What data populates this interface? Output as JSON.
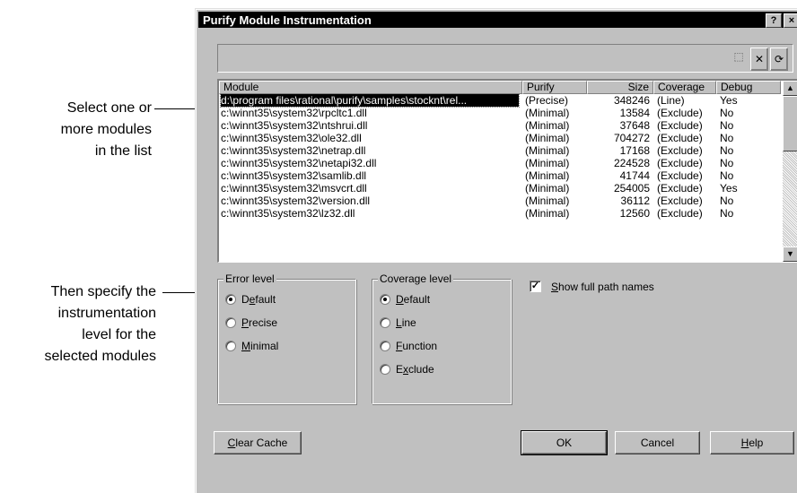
{
  "callouts": {
    "select": [
      "Select one or",
      "more modules",
      "in the list"
    ],
    "specify": [
      "Then specify the",
      "instrumentation",
      "level for the",
      "selected modules"
    ]
  },
  "window": {
    "title": "Purify Module Instrumentation",
    "help_btn": "?",
    "close_btn": "×"
  },
  "toolbar": {
    "icons": [
      "new-icon",
      "delete-icon",
      "refresh-icon"
    ],
    "delete_glyph": "✕",
    "refresh_glyph": "⟳",
    "new_glyph": "⬚"
  },
  "list": {
    "columns": [
      "Module",
      "Purify",
      "Size",
      "Coverage",
      "Debug"
    ],
    "rows": [
      [
        "d:\\program files\\rational\\purify\\samples\\stocknt\\rel...",
        "(Precise)",
        "348246",
        "(Line)",
        "Yes"
      ],
      [
        "c:\\winnt35\\system32\\rpcltc1.dll",
        "(Minimal)",
        "13584",
        "(Exclude)",
        "No"
      ],
      [
        "c:\\winnt35\\system32\\ntshrui.dll",
        "(Minimal)",
        "37648",
        "(Exclude)",
        "No"
      ],
      [
        "c:\\winnt35\\system32\\ole32.dll",
        "(Minimal)",
        "704272",
        "(Exclude)",
        "No"
      ],
      [
        "c:\\winnt35\\system32\\netrap.dll",
        "(Minimal)",
        "17168",
        "(Exclude)",
        "No"
      ],
      [
        "c:\\winnt35\\system32\\netapi32.dll",
        "(Minimal)",
        "224528",
        "(Exclude)",
        "No"
      ],
      [
        "c:\\winnt35\\system32\\samlib.dll",
        "(Minimal)",
        "41744",
        "(Exclude)",
        "No"
      ],
      [
        "c:\\winnt35\\system32\\msvcrt.dll",
        "(Minimal)",
        "254005",
        "(Exclude)",
        "Yes"
      ],
      [
        "c:\\winnt35\\system32\\version.dll",
        "(Minimal)",
        "36112",
        "(Exclude)",
        "No"
      ],
      [
        "c:\\winnt35\\system32\\lz32.dll",
        "(Minimal)",
        "12560",
        "(Exclude)",
        "No"
      ]
    ],
    "scroll_up": "▲",
    "scroll_down": "▼"
  },
  "error_level": {
    "title": "Error level",
    "options": [
      {
        "pre": "D",
        "u": "e",
        "post": "fault",
        "selected": true
      },
      {
        "pre": "",
        "u": "P",
        "post": "recise",
        "selected": false
      },
      {
        "pre": "",
        "u": "M",
        "post": "inimal",
        "selected": false
      }
    ]
  },
  "coverage_level": {
    "title": "Coverage level",
    "options": [
      {
        "pre": "",
        "u": "D",
        "post": "efault",
        "selected": true
      },
      {
        "pre": "",
        "u": "L",
        "post": "ine",
        "selected": false
      },
      {
        "pre": "",
        "u": "F",
        "post": "unction",
        "selected": false
      },
      {
        "pre": "E",
        "u": "x",
        "post": "clude",
        "selected": false
      }
    ]
  },
  "show_full_path": {
    "u": "S",
    "post": "how full path names",
    "checked": true,
    "mark": "✓"
  },
  "buttons": {
    "clear_cache": {
      "u": "C",
      "post": "lear Cache"
    },
    "ok": "OK",
    "cancel": "Cancel",
    "help": {
      "u": "H",
      "post": "elp"
    }
  }
}
